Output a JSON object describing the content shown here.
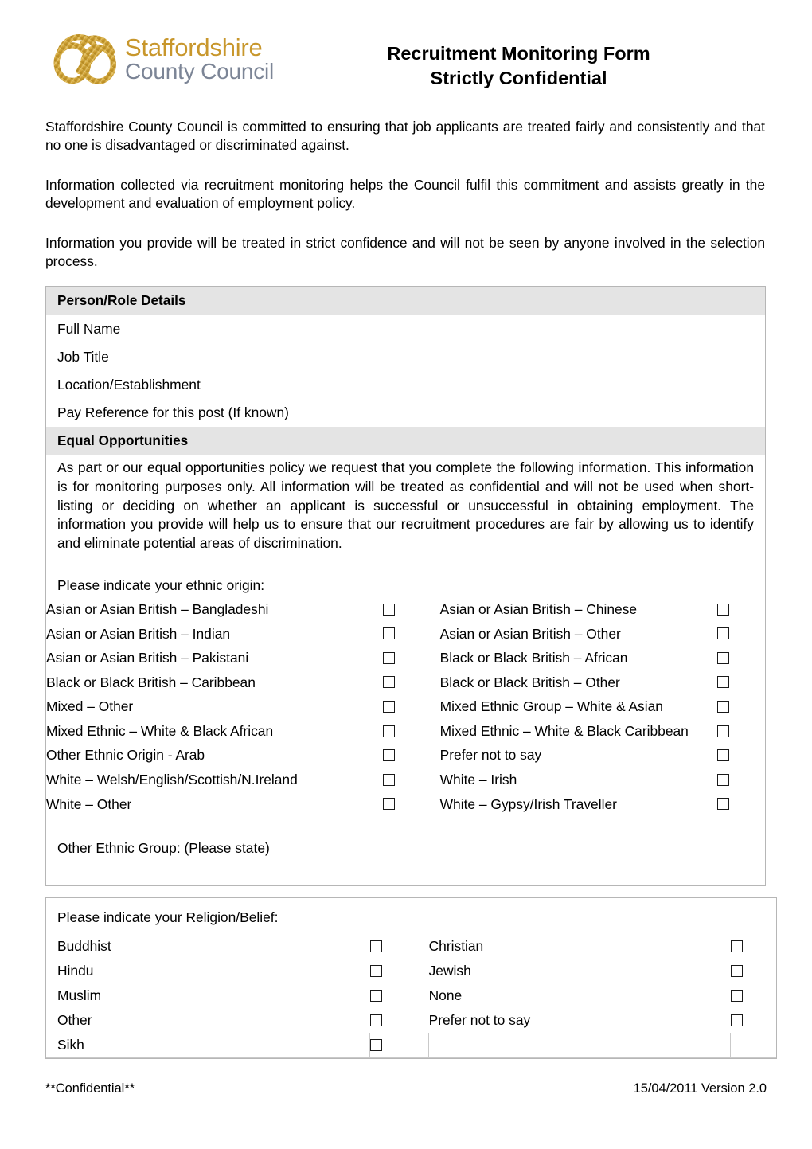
{
  "header": {
    "logo": {
      "icon": "staffordshire-knot-icon",
      "line1": "Staffordshire",
      "line2": "County Council",
      "gold": "#c8972c",
      "grey": "#7c8596"
    },
    "title_line1": "Recruitment Monitoring Form",
    "title_line2": "Strictly Confidential"
  },
  "intro": {
    "p1": "Staffordshire County Council is committed to ensuring that job applicants are treated fairly and consistently and that no one is disadvantaged or discriminated against.",
    "p2": "Information collected via recruitment monitoring helps the Council fulfil this commitment and assists greatly in the development and evaluation of employment policy.",
    "p3": "Information you provide will be treated in strict confidence and will not be seen by anyone involved in the selection process."
  },
  "person_role": {
    "heading": "Person/Role Details",
    "fields": [
      "Full Name",
      "Job Title",
      "Location/Establishment",
      "Pay Reference for this post (If known)"
    ]
  },
  "equal_opportunities": {
    "heading": "Equal Opportunities",
    "body": "As part or our equal opportunities policy we request that you complete the following information. This information is for monitoring purposes only. All information will be treated as confidential and will not be used when short-listing or deciding on whether an applicant is successful or unsuccessful in obtaining employment. The information you provide will help us to ensure that our recruitment procedures are fair by allowing us to identify and eliminate potential areas of discrimination."
  },
  "ethnic": {
    "prompt": "Please indicate your ethnic origin:",
    "rows": [
      {
        "left": "Asian or Asian British – Bangladeshi",
        "right": "Asian or Asian British – Chinese"
      },
      {
        "left": "Asian or Asian British – Indian",
        "right": "Asian or Asian British – Other"
      },
      {
        "left": "Asian or Asian British – Pakistani",
        "right": "Black or Black British – African"
      },
      {
        "left": "Black or Black British – Caribbean",
        "right": "Black or Black British – Other"
      },
      {
        "left": "Mixed – Other",
        "right": "Mixed Ethnic Group – White & Asian"
      },
      {
        "left": "Mixed Ethnic – White & Black African",
        "right": "Mixed Ethnic – White & Black Caribbean"
      },
      {
        "left": "Other Ethnic Origin - Arab",
        "right": "Prefer not to say"
      },
      {
        "left": "White – Welsh/English/Scottish/N.Ireland",
        "right": "White – Irish"
      },
      {
        "left": "White – Other",
        "right": "White – Gypsy/Irish Traveller"
      }
    ],
    "other_group_label": "Other Ethnic Group: (Please state)"
  },
  "religion": {
    "prompt": "Please indicate your Religion/Belief:",
    "rows": [
      {
        "left": "Buddhist",
        "right": "Christian"
      },
      {
        "left": "Hindu",
        "right": "Jewish"
      },
      {
        "left": "Muslim",
        "right": "None"
      },
      {
        "left": "Other",
        "right": "Prefer not to say"
      },
      {
        "left": "Sikh",
        "right": ""
      }
    ]
  },
  "footer": {
    "left": "**Confidential**",
    "right": "15/04/2011 Version 2.0"
  }
}
